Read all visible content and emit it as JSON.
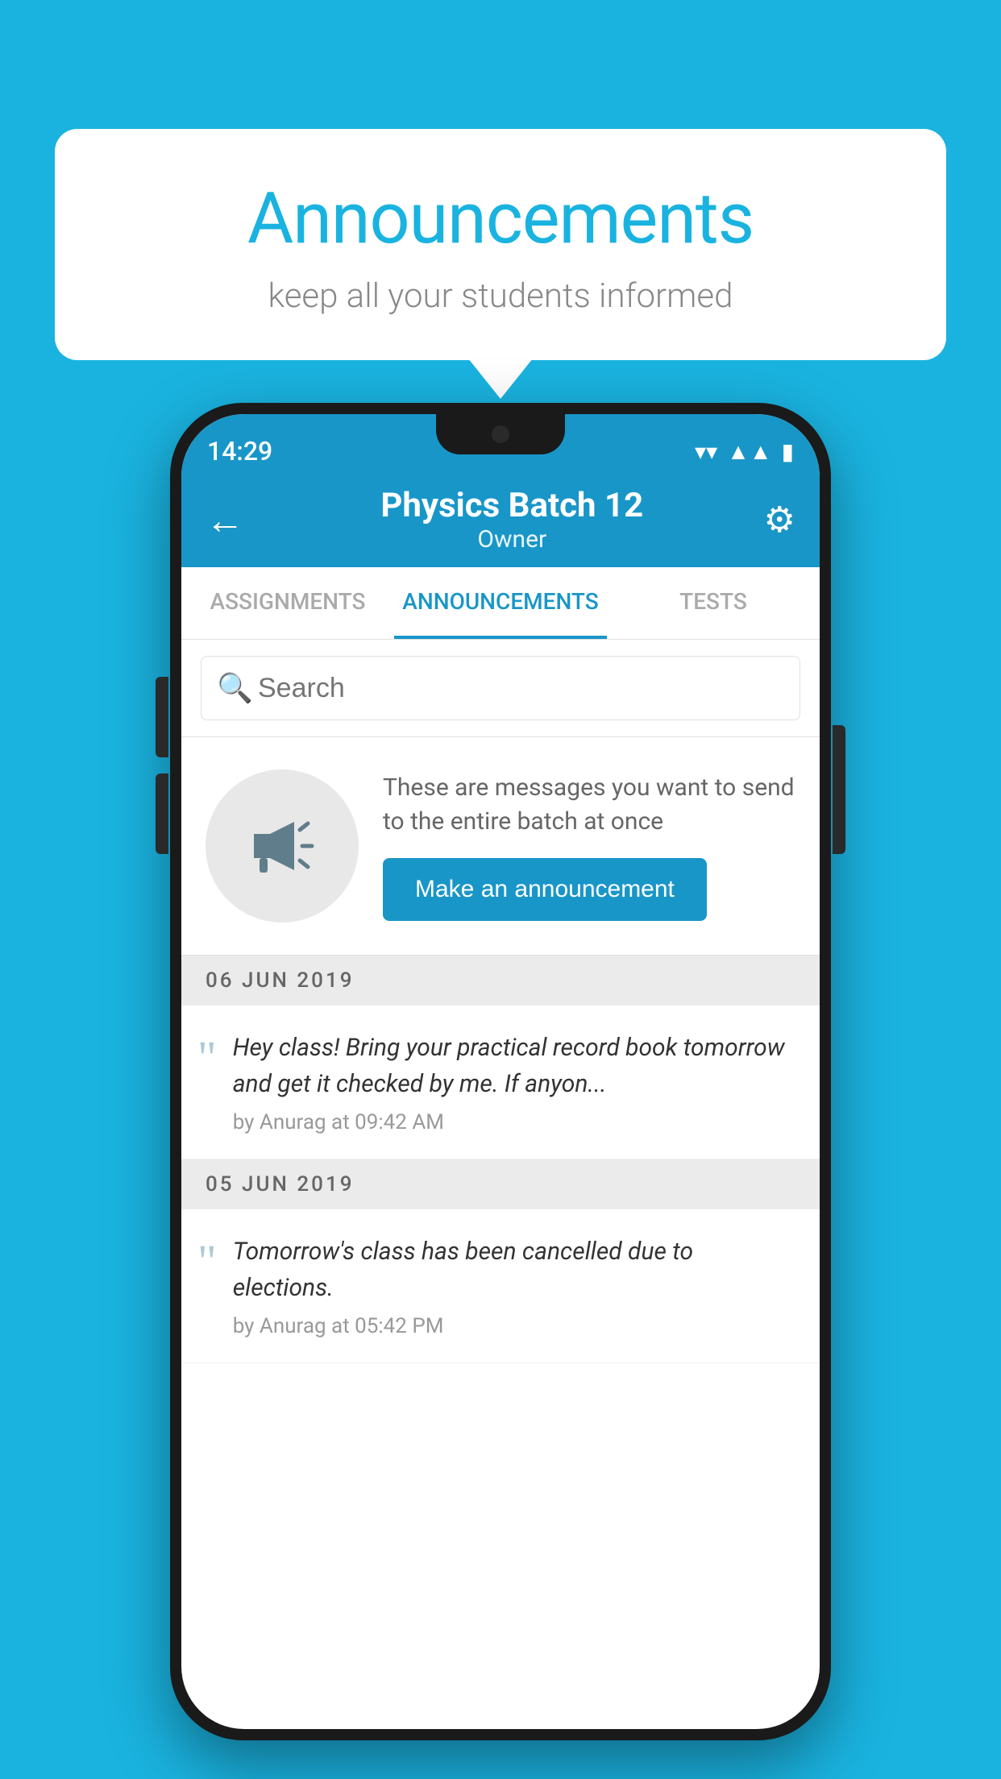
{
  "background_color": "#1ab3e0",
  "speech_bubble": {
    "title": "Announcements",
    "subtitle": "keep all your students informed"
  },
  "phone": {
    "status_bar": {
      "time": "14:29"
    },
    "app_bar": {
      "title": "Physics Batch 12",
      "subtitle": "Owner",
      "back_label": "←",
      "settings_label": "⚙"
    },
    "tabs": [
      {
        "label": "ASSIGNMENTS",
        "active": false
      },
      {
        "label": "ANNOUNCEMENTS",
        "active": true
      },
      {
        "label": "TESTS",
        "active": false
      }
    ],
    "search": {
      "placeholder": "Search"
    },
    "announcement_prompt": {
      "description": "These are messages you want to send to the entire batch at once",
      "button_label": "Make an announcement"
    },
    "announcements": [
      {
        "date": "06  JUN  2019",
        "text": "Hey class! Bring your practical record book tomorrow and get it checked by me. If anyon...",
        "meta": "by Anurag at 09:42 AM"
      },
      {
        "date": "05  JUN  2019",
        "text": "Tomorrow's class has been cancelled due to elections.",
        "meta": "by Anurag at 05:42 PM"
      }
    ]
  }
}
